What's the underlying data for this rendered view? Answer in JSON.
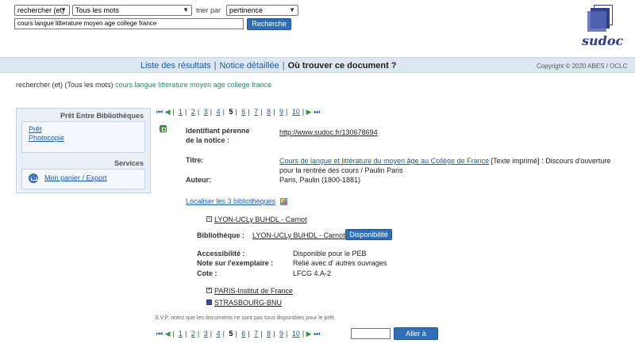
{
  "search": {
    "operator": "rechercher (et)",
    "field": "Tous les mots",
    "sort_label": "trier par",
    "sort_value": "pertinence",
    "query": "cours langue litterature moyen age college france",
    "button": "Recherche"
  },
  "logo": "sudoc",
  "nav": {
    "results": "Liste des résultats",
    "detail": "Notice détaillée",
    "where": "Où trouver ce document ?",
    "sep": "|",
    "copyright": "Copyright © 2020 ABES / OCLC"
  },
  "recap": {
    "prefix": "rechercher (et) (Tous les mots)",
    "query": "cours langue litterature moyen age college france"
  },
  "sidebar": {
    "peb_title": "Prêt Entre Bibliothèques",
    "peb_links": [
      "Prêt",
      "Photocopie"
    ],
    "services_title": "Services",
    "basket": "Mon panier / Export"
  },
  "pager": {
    "pages": [
      "1",
      "2",
      "3",
      "4",
      "5",
      "6",
      "7",
      "8",
      "9",
      "10"
    ],
    "current": "5",
    "sep": "|"
  },
  "record": {
    "id_label": "Identifiant pérenne de la notice :",
    "id_label_l1": "Identifiant pérenne",
    "id_label_l2": "de la notice :",
    "id_value": "http://www.sudoc.fr/130678694",
    "title_label": "Titre:",
    "title_link": "Cours de langue et littérature du moyen âge au Collège de France",
    "title_rest": " [Texte imprimé] : Discours d'ouverture",
    "title_line2": "pour la rentrée des cours / Paulin Paris",
    "author_label": "Auteur:",
    "author_value": "Paris, Paulin (1800-1881)",
    "localize": "Localiser les 3 bibliothèques"
  },
  "holdings": {
    "lib1": "LYON-UCLy BUHDL - Carnot",
    "bib_label": "Bibliothèque :",
    "bib_value": "LYON-UCLy BUHDL - Carnot",
    "dispo_button": "Disponibilité",
    "access_label": "Accessibilité :",
    "access_value": "Disponible pour le PEB",
    "note_label": "Note sur l'exemplaire :",
    "note_value": "Relié avec d' autres ouvrages",
    "cote_label": "Cote :",
    "cote_value": "LFCG 4.A-2",
    "lib2": "PARIS-Institut de France",
    "lib3": "STRASBOURG-BNU"
  },
  "footnote": "S.V.P. notez que les documents ne sont pas tous disponibles pour le prêt.",
  "goto_button": "Aller à",
  "colors": {
    "nav_bg": "#dde7f2",
    "link": "#1d5ea8",
    "button": "#2f6fb7"
  }
}
